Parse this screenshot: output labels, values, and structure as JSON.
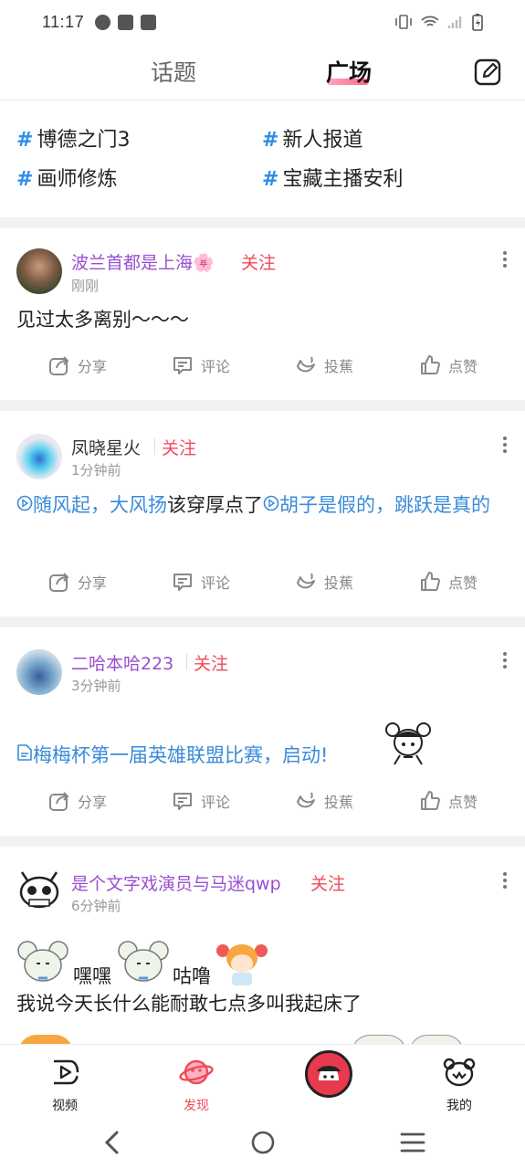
{
  "status_bar": {
    "time": "11:17"
  },
  "header": {
    "tabs": [
      "话题",
      "广场"
    ],
    "active_tab": "广场"
  },
  "topics": [
    "博德之门3",
    "新人报道",
    "画师修炼",
    "宝藏主播安利"
  ],
  "posts": [
    {
      "user": "波兰首都是上海🌸",
      "follow": "关注",
      "time": "刚刚",
      "text": "见过太多离别～～～"
    },
    {
      "user": "凤晓星火",
      "follow": "关注",
      "time": "1分钟前",
      "link1": "随风起，大风扬",
      "mid": "该穿厚点了",
      "link2": "胡子是假的，跳跃是真的"
    },
    {
      "user": "二哈本哈223",
      "follow": "关注",
      "time": "3分钟前",
      "link": "梅梅杯第一届英雄联盟比赛，启动!"
    },
    {
      "user": "是个文字戏演员与马迷qwp",
      "follow": "关注",
      "time": "6分钟前",
      "sticker_text1": "嘿嘿",
      "sticker_text2": "咕噜",
      "text": "我说今天长什么能耐敢七点多叫我起床了"
    }
  ],
  "actions": {
    "share": "分享",
    "comment": "评论",
    "banana": "投蕉",
    "like": "点赞"
  },
  "bottom_nav": {
    "video": "视频",
    "discover": "发现",
    "mine": "我的"
  },
  "colors": {
    "accent": "#f04a5a",
    "link": "#3a8bd9",
    "username": "#9a4fd0",
    "hash": "#2e8ee8"
  }
}
